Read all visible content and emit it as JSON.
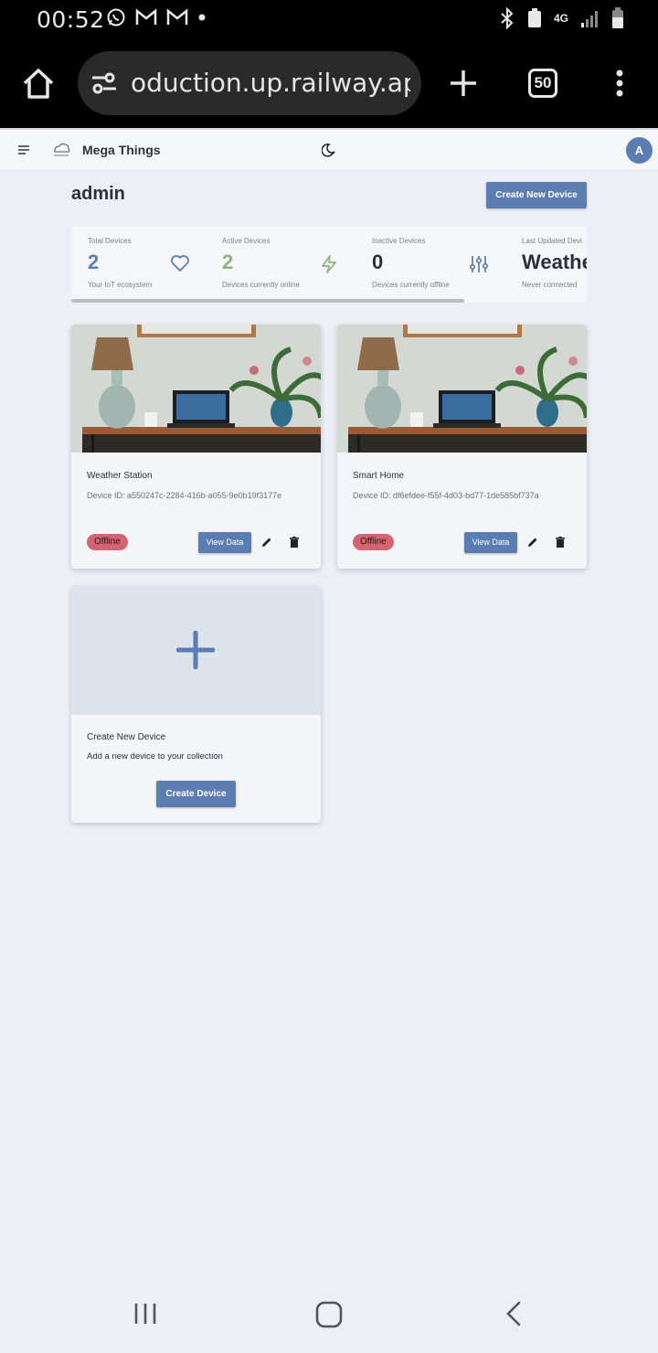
{
  "status_bar": {
    "time": "00:52",
    "network": "4G"
  },
  "browser": {
    "url": "oduction.up.railway.app",
    "tab_count": "50"
  },
  "app": {
    "brand": "Mega Things",
    "avatar_initial": "A",
    "page_title": "admin",
    "create_new_device_label": "Create New Device"
  },
  "stats": [
    {
      "label": "Total Devices",
      "value": "2",
      "sub": "Your IoT ecosystem",
      "color": "#5b7db1",
      "icon": "heart-icon"
    },
    {
      "label": "Active Devices",
      "value": "2",
      "sub": "Devices currently online",
      "color": "#8fb37a",
      "icon": "lightning-icon"
    },
    {
      "label": "Inactive Devices",
      "value": "0",
      "sub": "Devices currently offline",
      "color": "#2b2f38",
      "icon": "sliders-icon"
    },
    {
      "label": "Last Updated Devi",
      "value": "Weathe",
      "sub": "Never connected",
      "color": "#2b2f38",
      "icon": ""
    }
  ],
  "devices": [
    {
      "name": "Weather Station",
      "device_id": "Device ID: a550247c-2284-416b-a055-9e0b19f3177e",
      "status": "Offline",
      "view_label": "View Data"
    },
    {
      "name": "Smart Home",
      "device_id": "Device ID: df6efdee-f55f-4d03-bd77-1de585bf737a",
      "status": "Offline",
      "view_label": "View Data"
    }
  ],
  "new_device_card": {
    "title": "Create New Device",
    "description": "Add a new device to your collection",
    "button_label": "Create Device"
  },
  "colors": {
    "accent": "#5b7db1",
    "offline_badge": "#d26670",
    "background": "#eceff5"
  }
}
